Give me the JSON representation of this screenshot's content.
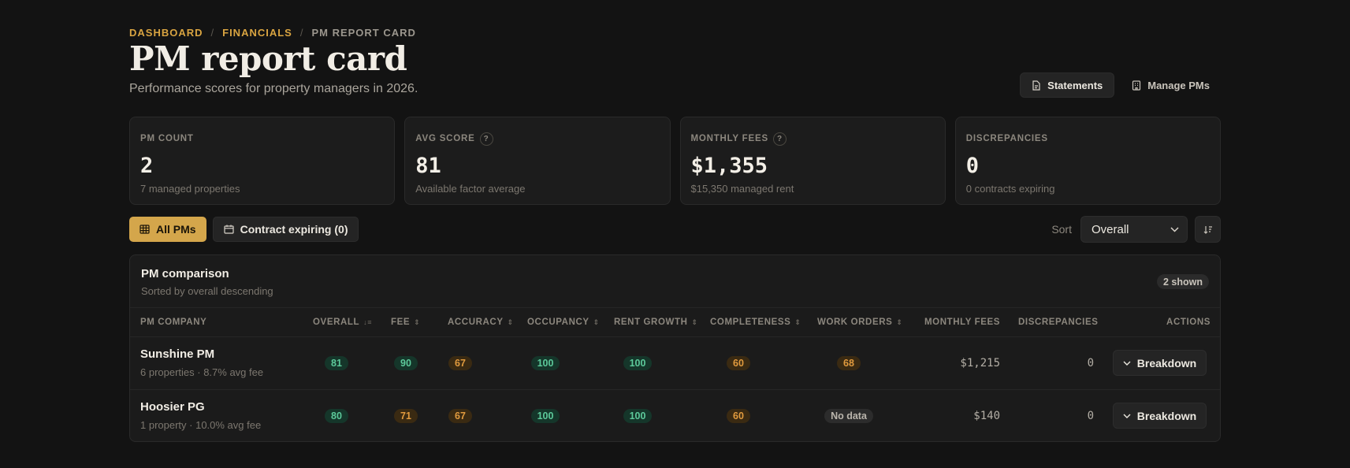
{
  "breadcrumb": {
    "items": [
      "DASHBOARD",
      "FINANCIALS"
    ],
    "current": "PM REPORT CARD",
    "separator": "/"
  },
  "page": {
    "title": "PM report card",
    "subtitle": "Performance scores for property managers in 2026."
  },
  "header_actions": {
    "statements_label": "Statements",
    "manage_label": "Manage PMs"
  },
  "cards": [
    {
      "label": "PM COUNT",
      "value": "2",
      "sub": "7 managed properties",
      "help": false
    },
    {
      "label": "AVG SCORE",
      "value": "81",
      "sub": "Available factor average",
      "help": true
    },
    {
      "label": "MONTHLY FEES",
      "value": "$1,355",
      "sub": "$15,350 managed rent",
      "help": true
    },
    {
      "label": "DISCREPANCIES",
      "value": "0",
      "sub": "0 contracts expiring",
      "help": false
    }
  ],
  "help_glyph": "?",
  "filters": {
    "all_label": "All PMs",
    "expiring_label": "Contract expiring (0)"
  },
  "sort": {
    "label": "Sort",
    "selected": "Overall"
  },
  "panel": {
    "title": "PM comparison",
    "subtitle": "Sorted by overall descending",
    "shown": "2 shown"
  },
  "columns": {
    "company": "PM COMPANY",
    "overall": "OVERALL",
    "fee": "FEE",
    "accuracy": "ACCURACY",
    "occupancy": "OCCUPANCY",
    "rent_growth": "RENT GROWTH",
    "completeness": "COMPLETENESS",
    "work_orders": "WORK ORDERS",
    "monthly_fees": "MONTHLY FEES",
    "discrepancies": "DISCREPANCIES",
    "actions": "ACTIONS"
  },
  "rows": [
    {
      "name": "Sunshine PM",
      "meta": "6 properties · 8.7% avg fee",
      "overall": "81",
      "fee": "90",
      "accuracy": "67",
      "occupancy": "100",
      "rent_growth": "100",
      "completeness": "60",
      "work_orders": "68",
      "monthly_fees": "$1,215",
      "discrepancies": "0",
      "action": "Breakdown"
    },
    {
      "name": "Hoosier PG",
      "meta": "1 property · 10.0% avg fee",
      "overall": "80",
      "fee": "71",
      "accuracy": "67",
      "occupancy": "100",
      "rent_growth": "100",
      "completeness": "60",
      "work_orders": "No data",
      "monthly_fees": "$140",
      "discrepancies": "0",
      "action": "Breakdown"
    }
  ],
  "colors": {
    "accent": "#d4a64b",
    "good": "#5cc99a",
    "warn": "#e09a3e",
    "background": "#131313"
  }
}
